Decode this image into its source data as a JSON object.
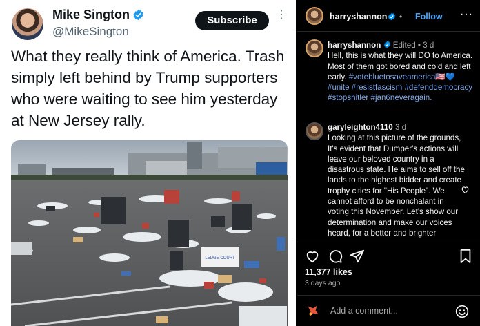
{
  "tweet": {
    "author_name": "Mike Sington",
    "handle": "@MikeSington",
    "subscribe_label": "Subscribe",
    "more_label": "⋮",
    "body": "What they really think of America. Trash simply left behind by Trump supporters who were waiting to see him yesterday at New Jersey rally.",
    "bus_sign": "LEDGE COURT"
  },
  "instagram": {
    "header": {
      "username": "harryshannon",
      "separator": "•",
      "follow_label": "Follow",
      "more_label": "···"
    },
    "caption": {
      "username": "harryshannon",
      "meta": "Edited • 3 d",
      "text": "Hell, this is what they will DO to America. Most of them got bored and cold and left early.",
      "hashtags": "#votebluetosaveamerica🇺🇸💙 #unite #resistfascism #defenddemocracy #stopshitler #jan6neveragain."
    },
    "comment": {
      "username": "garyleighton4110",
      "meta": "3 d",
      "text": "Looking at this picture of the grounds, It's evident that Dumper's actions will leave our beloved country in a disastrous state. He aims to sell off the lands to the highest bidder and create trophy cities for \"His People\". We cannot afford to be nonchalant in voting this November. Let's show our determination and make our voices heard, for a better and brighter"
    },
    "likes": "11,377 likes",
    "time_ago": "3 days ago",
    "comment_placeholder": "Add a comment...",
    "icons": [
      "heart-icon",
      "comment-icon",
      "share-icon",
      "bookmark-icon",
      "emoji-icon",
      "verified-icon"
    ]
  },
  "colors": {
    "verified": "#1d9bf0",
    "follow": "#4aa3f7",
    "hashtag": "#7ea7e8",
    "ig_bg": "#000000"
  }
}
